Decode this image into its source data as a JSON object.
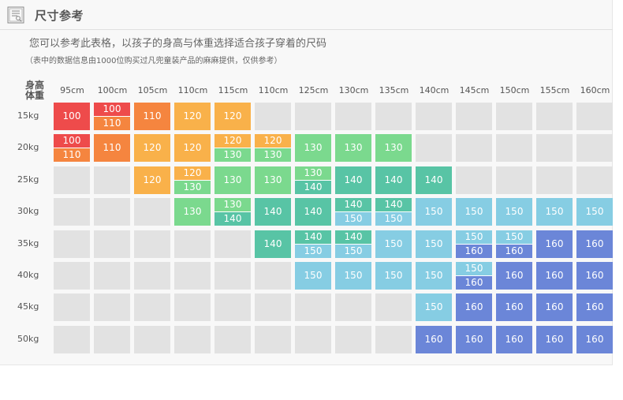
{
  "header": {
    "title": "尺寸参考",
    "icon": "size-chart-icon"
  },
  "intro": {
    "main": "您可以参考此表格，以孩子的身高与体重选择适合孩子穿着的尺码",
    "note": "（表中的数据信息由1000位购买过凡兜童装产品的麻麻提供，仅供参考）"
  },
  "corner": {
    "height": "身高",
    "weight": "体重"
  },
  "columns": [
    "95cm",
    "100cm",
    "105cm",
    "110cm",
    "115cm",
    "110cm",
    "125cm",
    "130cm",
    "135cm",
    "140cm",
    "145cm",
    "150cm",
    "155cm",
    "160cm"
  ],
  "rows": [
    "15kg",
    "20kg",
    "25kg",
    "30kg",
    "35kg",
    "40kg",
    "45kg",
    "50kg"
  ],
  "size_colors": {
    "100": "#ee4b4b",
    "110": "#f5853f",
    "120": "#f9b14a",
    "130": "#7bd98e",
    "140": "#58c4a5",
    "150": "#86cde3",
    "160": "#6b86d8",
    "empty": "#e2e2e2"
  },
  "grid": [
    [
      [
        "100"
      ],
      [
        "100",
        "110"
      ],
      [
        "110"
      ],
      [
        "120"
      ],
      [
        "120"
      ],
      [],
      [],
      [],
      [],
      [],
      [],
      [],
      [],
      []
    ],
    [
      [
        "100",
        "110"
      ],
      [
        "110"
      ],
      [
        "120"
      ],
      [
        "120"
      ],
      [
        "120",
        "130"
      ],
      [
        "120",
        "130"
      ],
      [
        "130"
      ],
      [
        "130"
      ],
      [
        "130"
      ],
      [],
      [],
      [],
      [],
      []
    ],
    [
      [],
      [],
      [
        "120"
      ],
      [
        "120",
        "130"
      ],
      [
        "130"
      ],
      [
        "130"
      ],
      [
        "130",
        "140"
      ],
      [
        "140"
      ],
      [
        "140"
      ],
      [
        "140"
      ],
      [],
      [],
      [],
      []
    ],
    [
      [],
      [],
      [],
      [
        "130"
      ],
      [
        "130",
        "140"
      ],
      [
        "140"
      ],
      [
        "140"
      ],
      [
        "140",
        "150"
      ],
      [
        "140",
        "150"
      ],
      [
        "150"
      ],
      [
        "150"
      ],
      [
        "150"
      ],
      [
        "150"
      ],
      [
        "150"
      ]
    ],
    [
      [],
      [],
      [],
      [],
      [],
      [
        "140"
      ],
      [
        "140",
        "150"
      ],
      [
        "140",
        "150"
      ],
      [
        "150"
      ],
      [
        "150"
      ],
      [
        "150",
        "160"
      ],
      [
        "150",
        "160"
      ],
      [
        "160"
      ],
      [
        "160"
      ]
    ],
    [
      [],
      [],
      [],
      [],
      [],
      [],
      [
        "150"
      ],
      [
        "150"
      ],
      [
        "150"
      ],
      [
        "150"
      ],
      [
        "150",
        "160"
      ],
      [
        "160"
      ],
      [
        "160"
      ],
      [
        "160"
      ]
    ],
    [
      [],
      [],
      [],
      [],
      [],
      [],
      [],
      [],
      [],
      [
        "150"
      ],
      [
        "160"
      ],
      [
        "160"
      ],
      [
        "160"
      ],
      [
        "160"
      ]
    ],
    [
      [],
      [],
      [],
      [],
      [],
      [],
      [],
      [],
      [],
      [
        "160"
      ],
      [
        "160"
      ],
      [
        "160"
      ],
      [
        "160"
      ],
      [
        "160"
      ]
    ]
  ]
}
